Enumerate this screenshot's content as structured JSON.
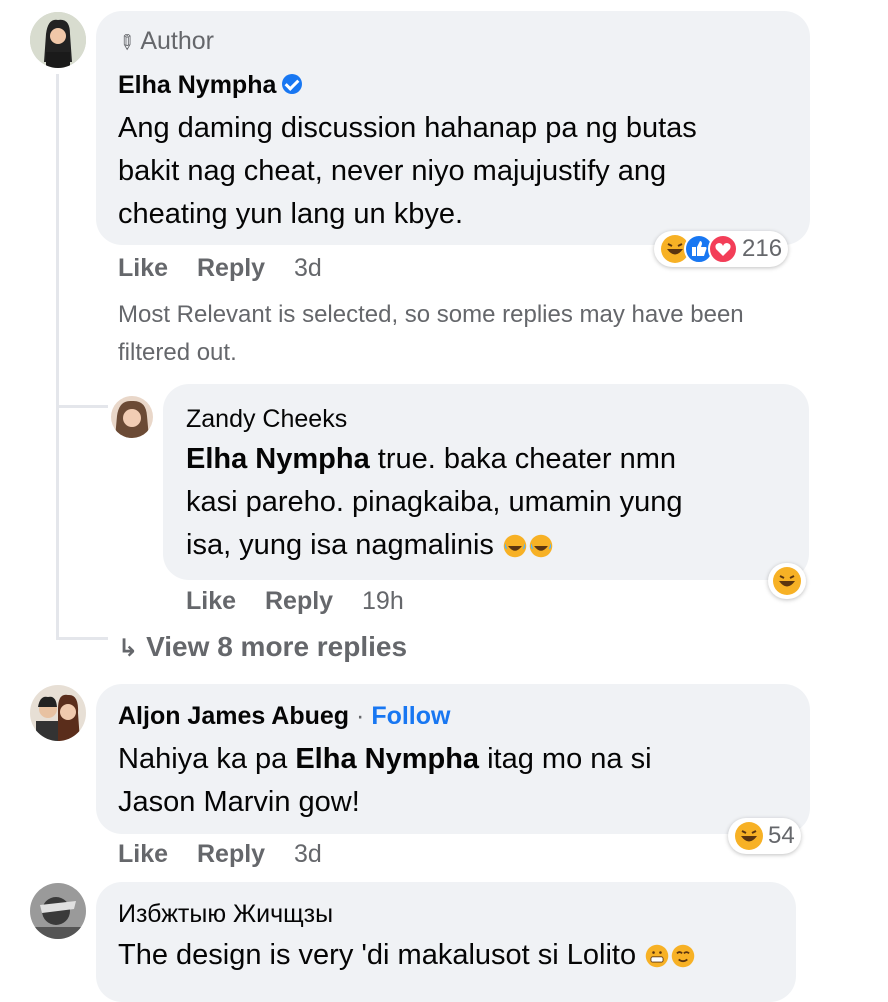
{
  "comments": [
    {
      "badge": "Author",
      "name": "Elha Nympha",
      "verified": true,
      "lines": [
        "Ang daming discussion hahanap pa ng butas",
        "bakit nag cheat, never niyo majujustify ang",
        "cheating yun lang un kbye."
      ],
      "reaction_count": "216",
      "reaction_icons": [
        "haha-emoji-icon",
        "like-icon",
        "love-icon"
      ],
      "actions": {
        "like": "Like",
        "reply": "Reply",
        "time": "3d"
      }
    },
    {
      "name": "Aljon James Abueg",
      "separator": "·",
      "follow": "Follow",
      "mention": "Elha Nympha",
      "line1_pre": "Nahiya ka pa ",
      "line1_post": " itag mo na si",
      "line2": "Jason Marvin gow!",
      "reaction_count": "54",
      "reaction_icons": [
        "haha-emoji-icon"
      ],
      "actions": {
        "like": "Like",
        "reply": "Reply",
        "time": "3d"
      }
    },
    {
      "name": "Избжтыю Жичщзы",
      "text": "The design is very 'di makalusot si Lolito"
    }
  ],
  "filter_notice": [
    "Most Relevant is selected, so some replies may have been",
    "filtered out."
  ],
  "reply": {
    "name": "Zandy Cheeks",
    "mention": "Elha Nympha",
    "line1_post": " true. baka cheater nmn",
    "line2": "kasi pareho. pinagkaiba, umamin yung",
    "line3": "isa, yung isa nagmalinis",
    "reaction_icons": [
      "haha-emoji-icon"
    ],
    "actions": {
      "like": "Like",
      "reply": "Reply",
      "time": "19h"
    }
  },
  "view_more": "View 8 more replies",
  "colors": {
    "bubble": "#f0f2f5",
    "link": "#1877f2",
    "meta": "#65676b",
    "love": "#f33e58",
    "haha": "#f7b125"
  }
}
